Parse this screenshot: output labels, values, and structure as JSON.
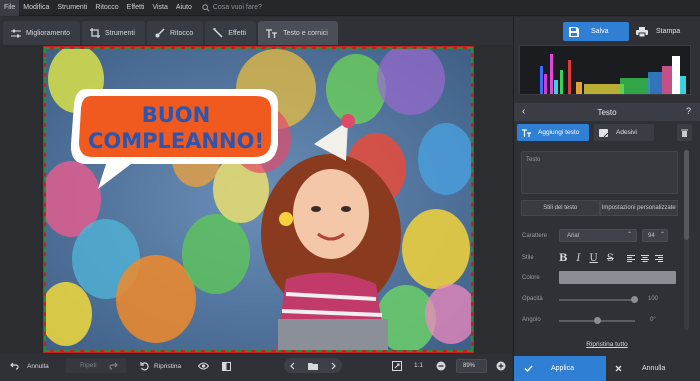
{
  "menu": {
    "items": [
      "File",
      "Modifica",
      "Strumenti",
      "Ritocco",
      "Effetti",
      "Vista",
      "Aiuto"
    ],
    "search_placeholder": "Cosa vuoi fare?"
  },
  "toolbar": {
    "tabs": [
      "Miglioramento",
      "Strumenti",
      "Ritocco",
      "Effetti",
      "Testo e cornici"
    ]
  },
  "actions": {
    "save": "Salva",
    "print": "Stampa"
  },
  "panel": {
    "title": "Testo",
    "add_text": "Aggiungi testo",
    "stickers": "Adesivi",
    "text_placeholder": "Testo",
    "style_tabs": [
      "Stili del testo",
      "Impostazioni personalizzate"
    ],
    "font_label": "Carattere",
    "font_value": "Arial",
    "size_value": "94",
    "style_label": "Stile",
    "style_buttons": [
      "B",
      "I",
      "U",
      "S"
    ],
    "color_label": "Colore",
    "opacity_label": "Opacità",
    "opacity_value": "100",
    "angle_label": "Angolo",
    "angle_value": "0°",
    "reset": "Ripristina tutto",
    "apply": "Applica",
    "cancel": "Annulla"
  },
  "bottom": {
    "undo": "Annulla",
    "redo": "Ripeti",
    "restore": "Ripristina",
    "ratio": "1:1",
    "zoom": "89%"
  },
  "image": {
    "speech_bubble_text_line1": "BUON",
    "speech_bubble_text_line2": "COMPLEANNO!",
    "frame_colors": {
      "outer": "#c81e24",
      "dash": "#2a8d3c"
    },
    "bubble_fill": "#f05a1e",
    "text_color": "#2a55b0"
  },
  "colors": {
    "accent": "#2f7fd4",
    "panel": "#2f3136",
    "bg": "#2b2d31"
  }
}
